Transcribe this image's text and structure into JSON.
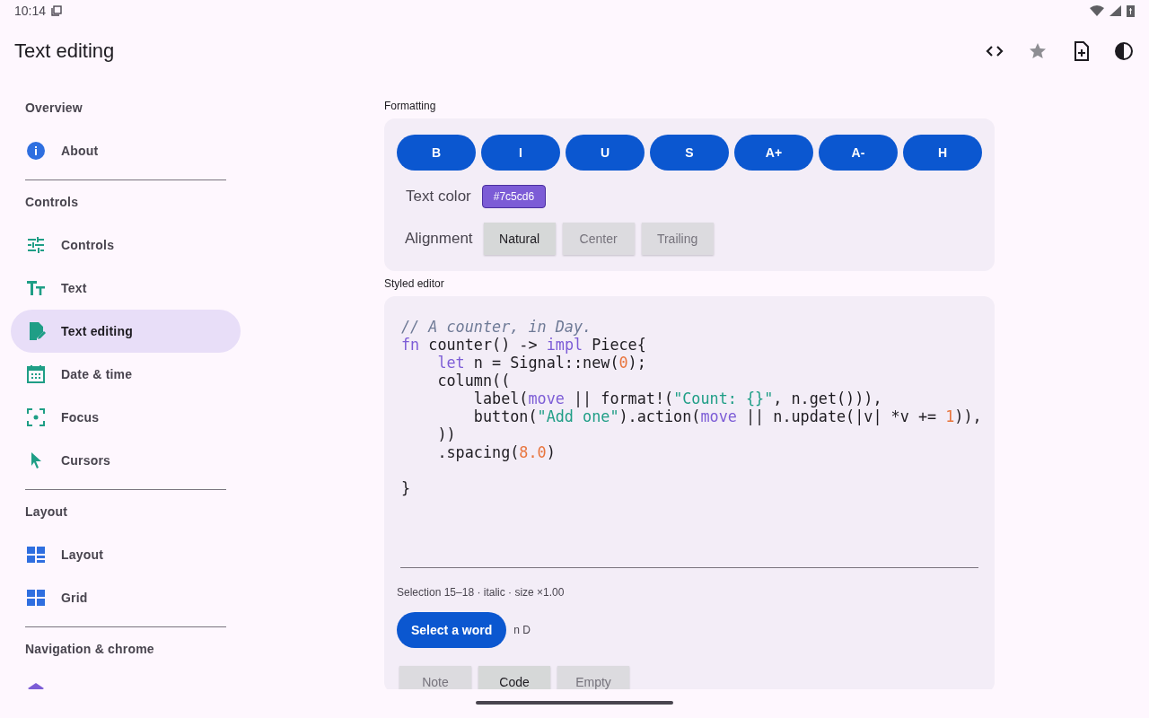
{
  "status_bar": {
    "time": "10:14"
  },
  "app_bar": {
    "title": "Text editing",
    "actions": [
      {
        "kind": "code"
      },
      {
        "kind": "star"
      },
      {
        "kind": "new-file"
      },
      {
        "kind": "contrast"
      }
    ]
  },
  "sidebar": {
    "sections": [
      {
        "header": "Overview",
        "items": [
          {
            "label": "About",
            "kind": "info",
            "selected": false
          }
        ]
      },
      {
        "header": "Controls",
        "items": [
          {
            "label": "Controls",
            "kind": "tune",
            "selected": false
          },
          {
            "label": "Text",
            "kind": "text",
            "selected": false
          },
          {
            "label": "Text editing",
            "kind": "edit",
            "selected": true
          },
          {
            "label": "Date & time",
            "kind": "calendar",
            "selected": false
          },
          {
            "label": "Focus",
            "kind": "focus",
            "selected": false
          },
          {
            "label": "Cursors",
            "kind": "cursor",
            "selected": false
          }
        ]
      },
      {
        "header": "Layout",
        "items": [
          {
            "label": "Layout",
            "kind": "layout",
            "selected": false
          },
          {
            "label": "Grid",
            "kind": "grid",
            "selected": false
          }
        ]
      },
      {
        "header": "Navigation & chrome",
        "items": [
          {
            "kind": "stack",
            "selected": false
          }
        ]
      }
    ]
  },
  "formatting": {
    "label": "Formatting",
    "buttons": [
      "B",
      "I",
      "U",
      "S",
      "A+",
      "A-",
      "H"
    ],
    "text_color": {
      "label": "Text color",
      "value": "#7c5cd6",
      "color": "#7c5cd6"
    },
    "alignment": {
      "label": "Alignment",
      "options": [
        {
          "label": "Natural",
          "selected": true
        },
        {
          "label": "Center",
          "selected": false
        },
        {
          "label": "Trailing",
          "selected": false
        }
      ]
    }
  },
  "editor": {
    "label": "Styled editor",
    "lines": [
      {
        "tokens": [
          {
            "kind": "comment",
            "text": "// A counter, in Day."
          }
        ]
      },
      {
        "tokens": [
          {
            "kind": "keyword",
            "text": "fn"
          },
          {
            "kind": "plain",
            "text": " counter() -> "
          },
          {
            "kind": "keyword",
            "text": "impl"
          },
          {
            "kind": "plain",
            "text": " Piece{"
          }
        ]
      },
      {
        "tokens": [
          {
            "kind": "keyword",
            "text": "    let"
          },
          {
            "kind": "plain",
            "text": " n = Signal::new("
          },
          {
            "kind": "number",
            "text": "0"
          },
          {
            "kind": "plain",
            "text": ");"
          }
        ]
      },
      {
        "tokens": [
          {
            "kind": "plain",
            "text": "    column(("
          }
        ]
      },
      {
        "tokens": [
          {
            "kind": "plain",
            "text": "        label("
          },
          {
            "kind": "keyword",
            "text": "move"
          },
          {
            "kind": "plain",
            "text": " || format!("
          },
          {
            "kind": "string",
            "text": "\"Count: {}\""
          },
          {
            "kind": "plain",
            "text": ", n.get())),"
          }
        ]
      },
      {
        "tokens": [
          {
            "kind": "plain",
            "text": "        button("
          },
          {
            "kind": "string",
            "text": "\"Add one\""
          },
          {
            "kind": "plain",
            "text": ").action("
          },
          {
            "kind": "keyword",
            "text": "move"
          },
          {
            "kind": "plain",
            "text": " || n.update(|v| *v += "
          },
          {
            "kind": "number",
            "text": "1"
          },
          {
            "kind": "plain",
            "text": ")),"
          }
        ]
      },
      {
        "tokens": [
          {
            "kind": "plain",
            "text": "    ))"
          }
        ]
      },
      {
        "tokens": [
          {
            "kind": "plain",
            "text": "    .spacing("
          },
          {
            "kind": "number",
            "text": "8.0"
          },
          {
            "kind": "plain",
            "text": ")"
          }
        ]
      },
      {
        "tokens": [
          {
            "kind": "plain",
            "text": "}"
          }
        ],
        "blank_before": true
      }
    ],
    "selection_info": "Selection 15–18 · italic · size ×1.00",
    "select_button": "Select a word",
    "selection_text": "n D",
    "modes": [
      {
        "label": "Note",
        "selected": false
      },
      {
        "label": "Code",
        "selected": true
      },
      {
        "label": "Empty",
        "selected": false
      }
    ]
  }
}
